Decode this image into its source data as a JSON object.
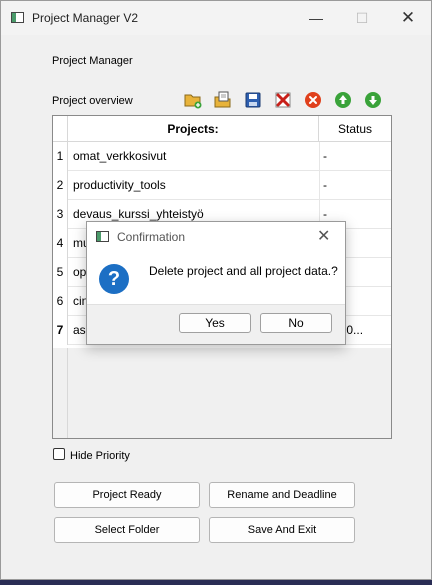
{
  "window": {
    "title": "Project Manager V2"
  },
  "header": {
    "label": "Project Manager",
    "overview_label": "Project overview"
  },
  "toolbar": {
    "icons": [
      "open-folder-icon",
      "open-file-icon",
      "save-icon",
      "delete-x-icon",
      "remove-circle-icon",
      "move-up-icon",
      "move-down-icon"
    ]
  },
  "table": {
    "headers": [
      "Projects:",
      "Status"
    ],
    "rows": [
      {
        "num": "1",
        "name": "omat_verkkosivut",
        "status": "-"
      },
      {
        "num": "2",
        "name": "productivity_tools",
        "status": "-"
      },
      {
        "num": "3",
        "name": "devaus_kurssi_yhteistyö",
        "status": "-"
      },
      {
        "num": "4",
        "name": "mu",
        "status": ""
      },
      {
        "num": "5",
        "name": "op",
        "status": ""
      },
      {
        "num": "6",
        "name": "cin",
        "status": ""
      },
      {
        "num": "7",
        "name": "asc",
        "status": "8h 20..."
      }
    ]
  },
  "options": {
    "hide_priority_label": "Hide Priority",
    "hide_priority_checked": false
  },
  "buttons": {
    "project_ready": "Project Ready",
    "rename_deadline": "Rename and Deadline",
    "select_folder": "Select Folder",
    "save_exit": "Save And Exit"
  },
  "dialog": {
    "title": "Confirmation",
    "message": "Delete project and all project data.?",
    "yes": "Yes",
    "no": "No"
  },
  "colors": {
    "accent": "#1c6fc4",
    "delete_red": "#e0401c",
    "arrow_green": "#3aa33a"
  }
}
